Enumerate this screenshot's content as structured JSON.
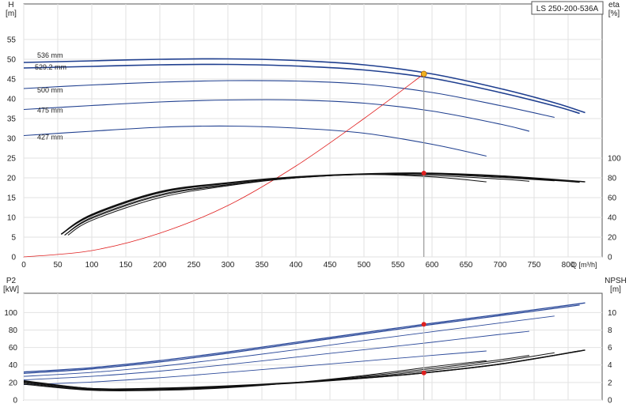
{
  "chart_data": [
    {
      "type": "line",
      "title": "LS 250-200-536A",
      "xlabel": "Q [m³/h]",
      "ylabel": "H\n[m]",
      "y2label": "eta\n[%]",
      "xlim": [
        0,
        850
      ],
      "ylim": [
        0,
        60
      ],
      "y2lim": [
        0,
        120
      ],
      "xticks": [
        0,
        50,
        100,
        150,
        200,
        250,
        300,
        350,
        400,
        450,
        500,
        550,
        600,
        650,
        700,
        750,
        800
      ],
      "yticks": [
        0,
        5,
        10,
        15,
        20,
        25,
        30,
        35,
        40,
        45,
        50,
        55
      ],
      "y2ticks": [
        0,
        20,
        40,
        60,
        80,
        100
      ],
      "grid": true,
      "head_curves": [
        {
          "name": "536 mm",
          "color": "#1f3f8f",
          "x": [
            0,
            100,
            200,
            300,
            400,
            500,
            600,
            700,
            780,
            825
          ],
          "y": [
            49.2,
            49.6,
            50.0,
            50.1,
            49.7,
            48.6,
            46.3,
            42.6,
            39.0,
            36.5
          ]
        },
        {
          "name": "529.2 mm",
          "color": "#1f3f8f",
          "x": [
            0,
            100,
            200,
            300,
            400,
            500,
            600,
            700,
            780,
            817
          ],
          "y": [
            47.8,
            48.2,
            48.6,
            48.7,
            48.3,
            47.3,
            45.2,
            41.6,
            38.2,
            36.3
          ]
        },
        {
          "name": "500 mm",
          "color": "#1f3f8f",
          "x": [
            0,
            100,
            200,
            300,
            400,
            500,
            600,
            700,
            780
          ],
          "y": [
            42.6,
            43.5,
            44.2,
            44.6,
            44.5,
            43.7,
            41.6,
            38.3,
            35.3
          ]
        },
        {
          "name": "475 mm",
          "color": "#1f3f8f",
          "x": [
            0,
            100,
            200,
            300,
            400,
            500,
            600,
            700,
            743
          ],
          "y": [
            37.3,
            38.3,
            39.2,
            39.7,
            39.7,
            38.9,
            36.9,
            33.6,
            31.8
          ]
        },
        {
          "name": "427 mm",
          "color": "#1f3f8f",
          "x": [
            0,
            100,
            200,
            300,
            400,
            500,
            600,
            680
          ],
          "y": [
            30.7,
            31.8,
            32.8,
            33.1,
            32.6,
            31.3,
            28.5,
            25.5
          ]
        }
      ],
      "system_curve": {
        "color": "#e02020",
        "x": [
          0,
          100,
          200,
          300,
          400,
          500,
          588
        ],
        "y": [
          0,
          1.6,
          6.0,
          13.0,
          23.0,
          35.0,
          46.3
        ]
      },
      "efficiency_curves": [
        {
          "x": [
            55,
            100,
            200,
            300,
            400,
            500,
            588,
            700,
            825
          ],
          "y": [
            11.5,
            21.5,
            33.0,
            37.5,
            40.5,
            42.0,
            42.4,
            41.0,
            38.0
          ]
        },
        {
          "x": [
            55,
            100,
            200,
            300,
            400,
            500,
            588,
            700,
            817
          ],
          "y": [
            11.5,
            21.0,
            32.5,
            37.2,
            40.3,
            41.8,
            42.2,
            40.7,
            37.8
          ]
        },
        {
          "x": [
            60,
            100,
            200,
            300,
            400,
            500,
            600,
            700,
            780
          ],
          "y": [
            11.0,
            20.0,
            31.5,
            36.6,
            40.0,
            41.8,
            41.8,
            40.2,
            38.5
          ]
        },
        {
          "x": [
            60,
            100,
            200,
            300,
            400,
            500,
            600,
            700,
            743
          ],
          "y": [
            11.0,
            19.5,
            31.0,
            36.4,
            40.0,
            41.8,
            41.2,
            39.4,
            38.3
          ]
        },
        {
          "x": [
            65,
            100,
            200,
            300,
            400,
            500,
            600,
            680
          ],
          "y": [
            11.0,
            18.5,
            30.0,
            36.0,
            40.0,
            41.7,
            40.5,
            38.0
          ]
        }
      ],
      "duty_point": {
        "q": 588,
        "h": 46.3,
        "eta": 42.4
      },
      "series_labels": [
        "536 mm",
        "529.2 mm",
        "500 mm",
        "475 mm",
        "427 mm"
      ]
    },
    {
      "type": "line",
      "ylabel": "P2\n[kW]",
      "y2label": "NPSH\n[m]",
      "xlim": [
        0,
        850
      ],
      "ylim": [
        0,
        120
      ],
      "y2lim": [
        0,
        12
      ],
      "yticks": [
        0,
        20,
        40,
        60,
        80,
        100
      ],
      "y2ticks": [
        0,
        2,
        4,
        6,
        8,
        10
      ],
      "grid": true,
      "power_curves": [
        {
          "x": [
            0,
            100,
            200,
            300,
            400,
            500,
            588,
            700,
            825
          ],
          "y": [
            32,
            37,
            45,
            55,
            66,
            77,
            86.5,
            98,
            111
          ]
        },
        {
          "x": [
            0,
            100,
            200,
            300,
            400,
            500,
            588,
            700,
            817
          ],
          "y": [
            30.5,
            35.5,
            43.5,
            53.5,
            64.5,
            75.5,
            85,
            96.5,
            108.5
          ]
        },
        {
          "x": [
            0,
            100,
            200,
            300,
            400,
            500,
            600,
            700,
            780
          ],
          "y": [
            27,
            31.5,
            38.5,
            47.5,
            57.5,
            68,
            78,
            88,
            96
          ]
        },
        {
          "x": [
            0,
            100,
            200,
            300,
            400,
            500,
            600,
            700,
            743
          ],
          "y": [
            23,
            27,
            33,
            40.5,
            49,
            57.5,
            66,
            75,
            78.5
          ]
        },
        {
          "x": [
            0,
            100,
            200,
            300,
            400,
            500,
            600,
            680
          ],
          "y": [
            17.5,
            20.5,
            25.5,
            31.5,
            38,
            44.5,
            51,
            56
          ]
        }
      ],
      "npsh_curves": [
        {
          "x": [
            0,
            100,
            200,
            300,
            400,
            500,
            588,
            700,
            825
          ],
          "y": [
            2.2,
            1.3,
            1.35,
            1.6,
            2.0,
            2.5,
            3.1,
            4.1,
            5.7
          ]
        },
        {
          "x": [
            0,
            100,
            200,
            300,
            400,
            500,
            588,
            700,
            817
          ],
          "y": [
            2.1,
            1.3,
            1.3,
            1.55,
            1.95,
            2.5,
            3.1,
            4.1,
            5.6
          ]
        },
        {
          "x": [
            0,
            100,
            200,
            300,
            400,
            500,
            600,
            700,
            780
          ],
          "y": [
            2.0,
            1.2,
            1.2,
            1.5,
            2.0,
            2.6,
            3.4,
            4.4,
            5.4
          ]
        },
        {
          "x": [
            0,
            100,
            200,
            300,
            400,
            500,
            600,
            700,
            743
          ],
          "y": [
            1.9,
            1.15,
            1.15,
            1.45,
            2.0,
            2.7,
            3.6,
            4.6,
            5.1
          ]
        },
        {
          "x": [
            0,
            100,
            200,
            300,
            400,
            500,
            600,
            680
          ],
          "y": [
            1.8,
            1.1,
            1.1,
            1.4,
            2.0,
            2.8,
            3.8,
            4.5
          ]
        }
      ],
      "duty_point": {
        "q": 588,
        "p2": 86.5,
        "npsh": 3.1
      }
    }
  ]
}
